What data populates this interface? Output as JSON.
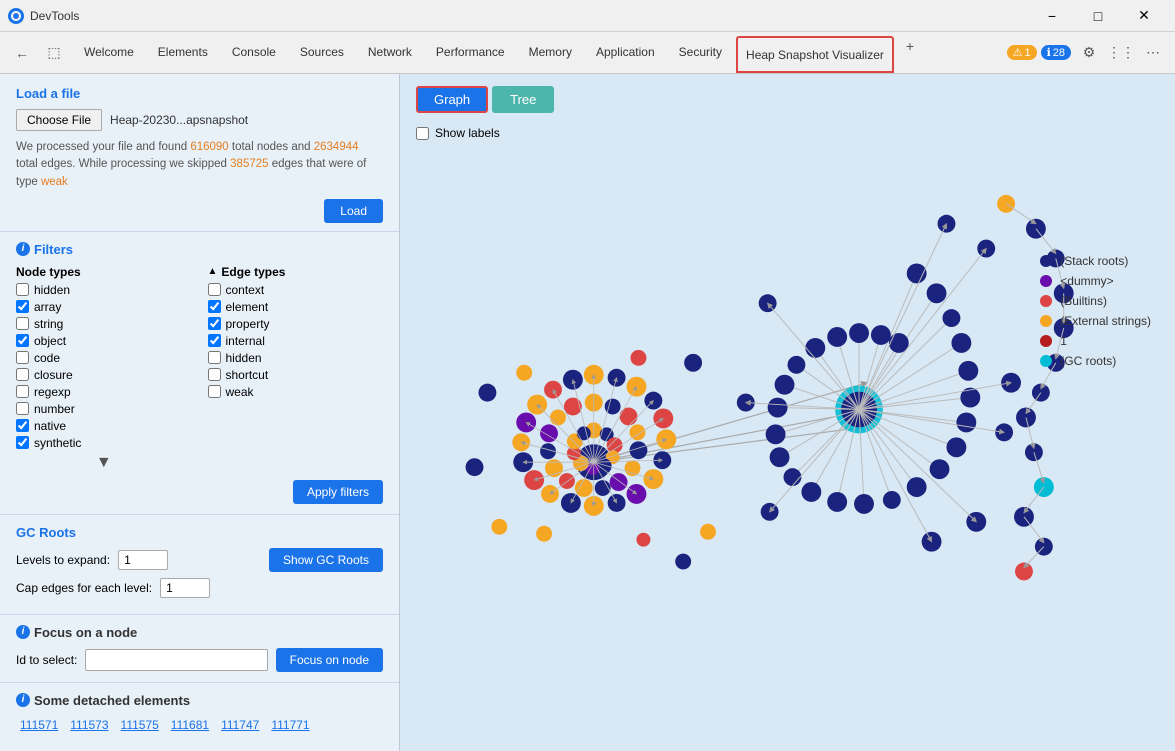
{
  "titleBar": {
    "logo": "devtools-logo",
    "title": "DevTools",
    "minimize": "−",
    "maximize": "□",
    "close": "✕"
  },
  "navBar": {
    "tabs": [
      {
        "label": "Welcome",
        "active": false
      },
      {
        "label": "Elements",
        "active": false
      },
      {
        "label": "Console",
        "active": false
      },
      {
        "label": "Sources",
        "active": false
      },
      {
        "label": "Network",
        "active": false
      },
      {
        "label": "Performance",
        "active": false
      },
      {
        "label": "Memory",
        "active": false
      },
      {
        "label": "Application",
        "active": false
      },
      {
        "label": "Security",
        "active": false
      },
      {
        "label": "Heap Snapshot Visualizer",
        "active": true
      }
    ],
    "addTab": "+",
    "warningCount": "1",
    "errorCount": "28"
  },
  "leftPanel": {
    "loadFile": {
      "title": "Load a file",
      "chooseFileBtn": "Choose File",
      "fileName": "Heap-20230...apsnapshot",
      "infoText1": "We processed your file and found ",
      "totalNodes": "616090",
      "infoText2": " total nodes and ",
      "totalEdges": "2634944",
      "infoText3": " total edges. While processing we skipped ",
      "skippedEdges": "385725",
      "infoText4": " edges that were of type ",
      "edgeType": "weak",
      "loadBtn": "Load"
    },
    "filters": {
      "title": "Filters",
      "nodeTypes": {
        "title": "Node types",
        "items": [
          {
            "label": "hidden",
            "checked": false
          },
          {
            "label": "array",
            "checked": true
          },
          {
            "label": "string",
            "checked": false
          },
          {
            "label": "object",
            "checked": true
          },
          {
            "label": "code",
            "checked": false
          },
          {
            "label": "closure",
            "checked": false
          },
          {
            "label": "regexp",
            "checked": false
          },
          {
            "label": "number",
            "checked": false
          },
          {
            "label": "native",
            "checked": true
          },
          {
            "label": "synthetic",
            "checked": true
          }
        ]
      },
      "edgeTypes": {
        "title": "Edge types",
        "items": [
          {
            "label": "context",
            "checked": false
          },
          {
            "label": "element",
            "checked": true
          },
          {
            "label": "property",
            "checked": true
          },
          {
            "label": "internal",
            "checked": true
          },
          {
            "label": "hidden",
            "checked": false
          },
          {
            "label": "shortcut",
            "checked": false
          },
          {
            "label": "weak",
            "checked": false
          }
        ]
      },
      "applyBtn": "Apply filters"
    },
    "gcRoots": {
      "title": "GC Roots",
      "levelsLabel": "Levels to expand:",
      "levelsValue": "1",
      "capLabel": "Cap edges for each level:",
      "capValue": "1",
      "showBtn": "Show GC Roots"
    },
    "focusNode": {
      "title": "Focus on a node",
      "idLabel": "Id to select:",
      "idValue": "",
      "focusBtn": "Focus on node"
    },
    "detached": {
      "title": "Some detached elements",
      "items": [
        "111571",
        "111573",
        "111575",
        "111681",
        "111747",
        "111771"
      ]
    }
  },
  "rightPanel": {
    "tabs": [
      {
        "label": "Graph",
        "active": true
      },
      {
        "label": "Tree",
        "active": false
      }
    ],
    "showLabels": "Show labels",
    "legend": [
      {
        "label": "(Stack roots)",
        "color": "#1a237e"
      },
      {
        "label": "<dummy>",
        "color": "#6a0dad"
      },
      {
        "label": "(Builtins)",
        "color": "#d44"
      },
      {
        "label": "(External strings)",
        "color": "#f5a623"
      },
      {
        "label": "1",
        "color": "#b71c1c"
      },
      {
        "label": "(GC roots)",
        "color": "#00bcd4"
      }
    ]
  }
}
